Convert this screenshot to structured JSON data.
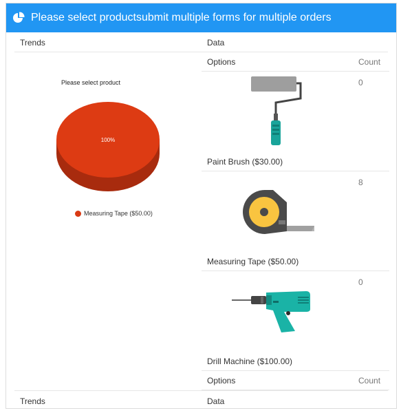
{
  "header": {
    "title": "Please select productsubmit multiple forms for multiple orders",
    "icon": "pie-chart-icon"
  },
  "table": {
    "trends_label": "Trends",
    "data_label": "Data",
    "options_label": "Options",
    "count_label": "Count"
  },
  "options": [
    {
      "name": "Paint Brush ($30.00)",
      "count": "0",
      "icon": "paint-roller-icon"
    },
    {
      "name": "Measuring Tape ($50.00)",
      "count": "8",
      "icon": "measuring-tape-icon"
    },
    {
      "name": "Drill Machine ($100.00)",
      "count": "0",
      "icon": "drill-machine-icon"
    }
  ],
  "chart_data": {
    "type": "pie",
    "title": "Please select product",
    "categories": [
      "Measuring Tape ($50.00)"
    ],
    "values": [
      100
    ],
    "data_labels": [
      "100%"
    ],
    "legend_position": "bottom",
    "colors": [
      "#d93a14"
    ]
  },
  "colors": {
    "header_bg": "#2196f3",
    "pie_top": "#dd3b13",
    "pie_side": "#a82b0e"
  }
}
